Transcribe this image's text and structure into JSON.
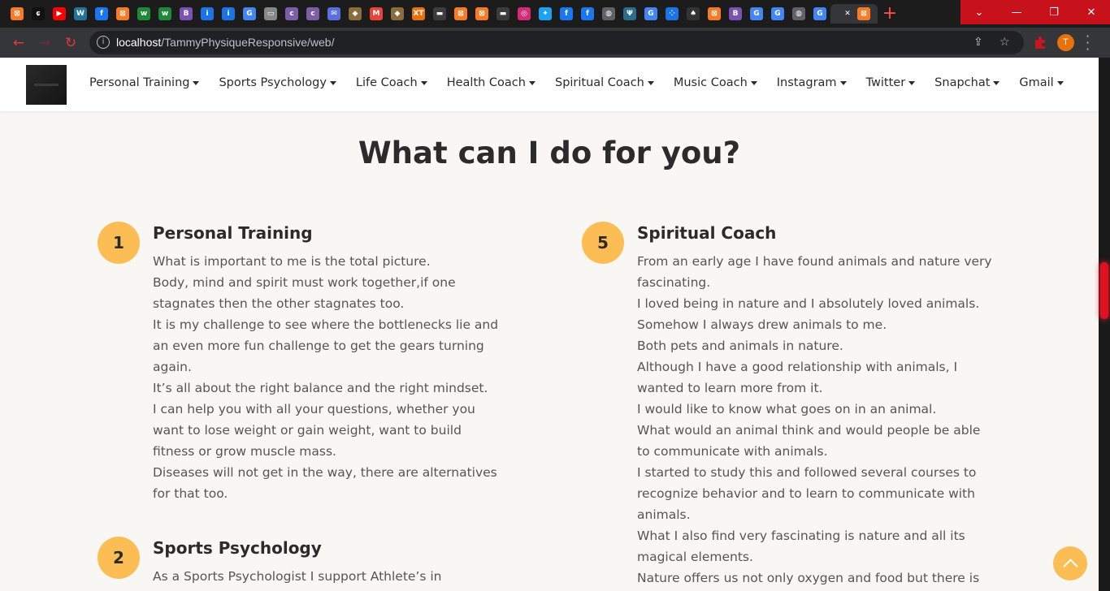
{
  "browser": {
    "tab_favicons": [
      {
        "icon": "xampp-icon",
        "glyph": "⊠",
        "color": "#fb7a24"
      },
      {
        "icon": "stopwatch-icon",
        "glyph": "ɕ",
        "color": "#111111"
      },
      {
        "icon": "youtube-icon",
        "glyph": "▶",
        "color": "#ff0000"
      },
      {
        "icon": "wordpress-icon",
        "glyph": "W",
        "color": "#21759b"
      },
      {
        "icon": "facebook-icon",
        "glyph": "f",
        "color": "#1877f2"
      },
      {
        "icon": "xampp-icon",
        "glyph": "⊠",
        "color": "#fb7a24"
      },
      {
        "icon": "w-app-icon",
        "glyph": "w",
        "color": "#1d8a3b"
      },
      {
        "icon": "w-app-icon",
        "glyph": "w",
        "color": "#1d8a3b"
      },
      {
        "icon": "bootstrap-icon",
        "glyph": "B",
        "color": "#7952b3"
      },
      {
        "icon": "info-icon",
        "glyph": "i",
        "color": "#1a73e8"
      },
      {
        "icon": "info-icon",
        "glyph": "i",
        "color": "#1a73e8"
      },
      {
        "icon": "google-icon",
        "glyph": "G",
        "color": "#4285f4"
      },
      {
        "icon": "card-icon",
        "glyph": "▭",
        "color": "#888888"
      },
      {
        "icon": "colorlib-icon",
        "glyph": "c",
        "color": "#7b5ea7"
      },
      {
        "icon": "colorlib-icon",
        "glyph": "c",
        "color": "#7b5ea7"
      },
      {
        "icon": "mail-icon",
        "glyph": "✉",
        "color": "#5b6ee1"
      },
      {
        "icon": "bird-icon",
        "glyph": "◆",
        "color": "#8a6d3b"
      },
      {
        "icon": "gmail-icon",
        "glyph": "M",
        "color": "#ea4335"
      },
      {
        "icon": "bird-icon",
        "glyph": "◆",
        "color": "#8a6d3b"
      },
      {
        "icon": "xt-icon",
        "glyph": "XT",
        "color": "#e8710a"
      },
      {
        "icon": "window-icon",
        "glyph": "▬",
        "color": "#3c3c3c"
      },
      {
        "icon": "xampp-icon",
        "glyph": "⊠",
        "color": "#fb7a24"
      },
      {
        "icon": "xampp-icon",
        "glyph": "⊠",
        "color": "#fb7a24"
      },
      {
        "icon": "window-icon",
        "glyph": "▬",
        "color": "#3c3c3c"
      },
      {
        "icon": "instagram-icon",
        "glyph": "◎",
        "color": "#d62976"
      },
      {
        "icon": "twitter-icon",
        "glyph": "✦",
        "color": "#1da1f2"
      },
      {
        "icon": "facebook-icon",
        "glyph": "f",
        "color": "#1877f2"
      },
      {
        "icon": "facebook-icon",
        "glyph": "f",
        "color": "#1877f2"
      },
      {
        "icon": "globe-icon",
        "glyph": "◍",
        "color": "#5f6368"
      },
      {
        "icon": "trident-icon",
        "glyph": "Ψ",
        "color": "#2a6e8a"
      },
      {
        "icon": "google-icon",
        "glyph": "G",
        "color": "#4285f4"
      },
      {
        "icon": "dots-icon",
        "glyph": "⁘",
        "color": "#1a73e8"
      },
      {
        "icon": "snapchat-icon",
        "glyph": "♠",
        "color": "#333333"
      },
      {
        "icon": "xampp-icon",
        "glyph": "⊠",
        "color": "#fb7a24"
      },
      {
        "icon": "bootstrap-icon",
        "glyph": "B",
        "color": "#7952b3"
      },
      {
        "icon": "google-icon",
        "glyph": "G",
        "color": "#4285f4"
      },
      {
        "icon": "google-icon",
        "glyph": "G",
        "color": "#4285f4"
      },
      {
        "icon": "globe-icon",
        "glyph": "◍",
        "color": "#5f6368"
      },
      {
        "icon": "google-icon",
        "glyph": "G",
        "color": "#4285f4"
      }
    ],
    "active_tab_close": "✕",
    "active_tab_icon": {
      "icon": "xampp-icon",
      "glyph": "⊠",
      "color": "#fb7a24"
    },
    "new_tab": "+",
    "window_controls": {
      "chevron": "⌄",
      "minimize": "—",
      "restore": "❐",
      "close": "✕"
    },
    "url_host": "localhost",
    "url_path": "/TammyPhysiqueResponsive/web/",
    "profile_initial": "T"
  },
  "site": {
    "nav_items": [
      "Personal Training",
      "Sports Psychology",
      "Life Coach",
      "Health Coach",
      "Spiritual Coach",
      "Music Coach",
      "Instagram",
      "Twitter",
      "Snapchat",
      "Gmail"
    ],
    "heading": "What can I do for you?",
    "features": {
      "one": {
        "number": "1",
        "title": "Personal Training",
        "lines": [
          "What is important to me is the total picture.",
          "Body, mind and spirit must work together,if one",
          "stagnates then the other stagnates too.",
          "It is my challenge to see where the bottlenecks lie and",
          "an even more fun challenge to get the gears turning",
          "again.",
          "It’s all about the right balance and the right mindset.",
          "I can help you with all your questions, whether you",
          "want to lose weight or gain weight, want to build",
          "fitness or grow muscle mass.",
          "Diseases will not get in the way, there are alternatives",
          "for that too."
        ]
      },
      "two": {
        "number": "2",
        "title": "Sports Psychology",
        "lines": [
          "As a Sports Psychologist I support Athlete’s in"
        ]
      },
      "five": {
        "number": "5",
        "title": "Spiritual Coach",
        "lines": [
          "From an early age I have found animals and nature very",
          "fascinating.",
          "I loved being in nature and I absolutely loved animals.",
          "Somehow I always drew animals to me.",
          "Both pets and animals in nature.",
          "Although I have a good relationship with animals, I",
          "wanted to learn more from it.",
          "I would like to know what goes on in an animal.",
          "What would an animal think and would people be able",
          "to communicate with animals.",
          "I started to study this and followed several courses to",
          "recognize behavior and to learn to communicate with",
          "animals.",
          "What I also find very fascinating is nature and all its",
          "magical elements.",
          "Nature offers us not only oxygen and food but there is"
        ]
      }
    },
    "accent_color": "#fcbe54"
  }
}
